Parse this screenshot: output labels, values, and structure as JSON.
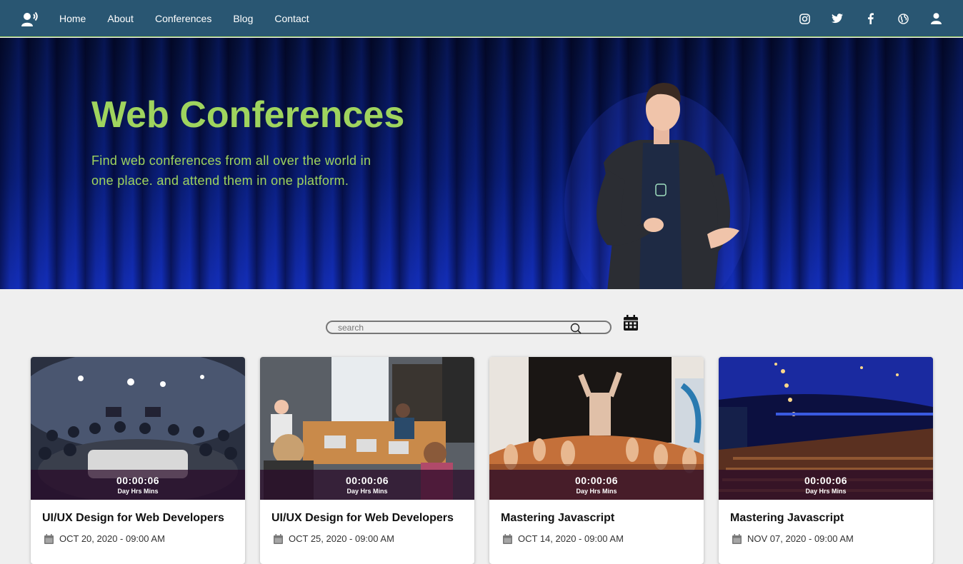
{
  "nav": {
    "logo_icon": "speaker-icon",
    "links": [
      "Home",
      "About",
      "Conferences",
      "Blog",
      "Contact"
    ],
    "icons": [
      "instagram-icon",
      "twitter-icon",
      "facebook-icon",
      "globe-icon",
      "user-icon"
    ]
  },
  "hero": {
    "title": "Web Conferences",
    "subtitle": "Find web conferences from all over the world in one place. and attend them in one platform."
  },
  "search": {
    "placeholder": "search"
  },
  "cards": [
    {
      "title": "UI/UX Design for Web Developers",
      "date": "OCT 20, 2020 - 09:00 AM",
      "timer": "00:00:06",
      "timer_units": "Day  Hrs  Mins"
    },
    {
      "title": "UI/UX Design for Web Developers",
      "date": "OCT 25, 2020 - 09:00 AM",
      "timer": "00:00:06",
      "timer_units": "Day  Hrs  Mins"
    },
    {
      "title": "Mastering Javascript",
      "date": "OCT 14, 2020 - 09:00 AM",
      "timer": "00:00:06",
      "timer_units": "Day  Hrs  Mins"
    },
    {
      "title": "Mastering Javascript",
      "date": "NOV 07, 2020 - 09:00 AM",
      "timer": "00:00:06",
      "timer_units": "Day  Hrs  Mins"
    }
  ],
  "colors": {
    "navbar": "#295672",
    "accent_green": "#9fd45e",
    "page_bg": "#efefef"
  }
}
